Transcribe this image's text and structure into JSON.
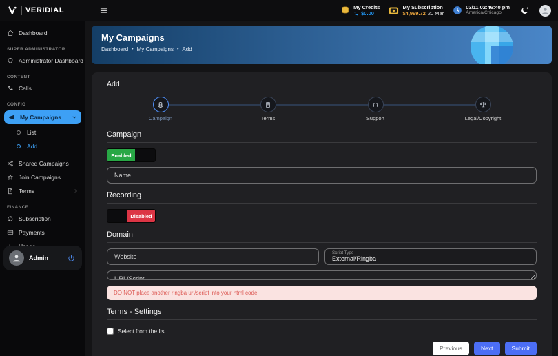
{
  "topbar": {
    "brand": "VERIDIAL",
    "credits": {
      "label": "My Credits",
      "value": "$0.00"
    },
    "subscription": {
      "label": "My Subscription",
      "value": "$4,999.72",
      "date": "20 Mar"
    },
    "clock": {
      "datetime": "03/11 02:46:40 pm",
      "timezone": "America/Chicago"
    }
  },
  "sidebar": {
    "sections": {
      "super_admin": "SUPER ADMINISTRATOR",
      "content": "CONTENT",
      "config": "CONFIG",
      "finance": "FINANCE"
    },
    "items": {
      "dashboard": "Dashboard",
      "admin_dashboard": "Administrator Dashboard",
      "calls": "Calls",
      "my_campaigns": "My Campaigns",
      "list": "List",
      "add": "Add",
      "shared_campaigns": "Shared Campaigns",
      "join_campaigns": "Join Campaigns",
      "terms": "Terms",
      "subscription": "Subscription",
      "payments": "Payments",
      "usage": "Usage"
    },
    "admin": {
      "name": "Admin"
    }
  },
  "banner": {
    "title": "My Campaigns",
    "breadcrumb": [
      "Dashboard",
      "My Campaigns",
      "Add"
    ],
    "separator": "•"
  },
  "form": {
    "title": "Add",
    "steps": [
      {
        "label": "Campaign"
      },
      {
        "label": "Terms"
      },
      {
        "label": "Support"
      },
      {
        "label": "Legal/Copyright"
      }
    ],
    "campaign": {
      "heading": "Campaign",
      "toggle_label": "Enabled",
      "name_placeholder": "Name"
    },
    "recording": {
      "heading": "Recording",
      "toggle_label": "Disabled"
    },
    "domain": {
      "heading": "Domain",
      "website_placeholder": "Website",
      "script_type_label": "Script Type",
      "script_type_value": "External/Ringba",
      "url_placeholder": "URL/Script",
      "warning": "DO NOT place another ringba url/script into your html code."
    },
    "terms_settings": {
      "heading": "Terms - Settings",
      "checkbox_label": "Select from the list"
    },
    "buttons": {
      "previous": "Previous",
      "next": "Next",
      "submit": "Submit"
    }
  },
  "colors": {
    "accent_blue": "#3da0f5",
    "button_blue": "#4c6ef5",
    "success_green": "#28a745",
    "danger_red": "#dc3545",
    "credits_blue": "#2196f3",
    "subscription_gold": "#e8a33d",
    "banner_gradient_from": "#143e66",
    "banner_gradient_to": "#4a86c8",
    "warning_bg": "#fae3e1",
    "warning_text": "#dd5a55"
  }
}
